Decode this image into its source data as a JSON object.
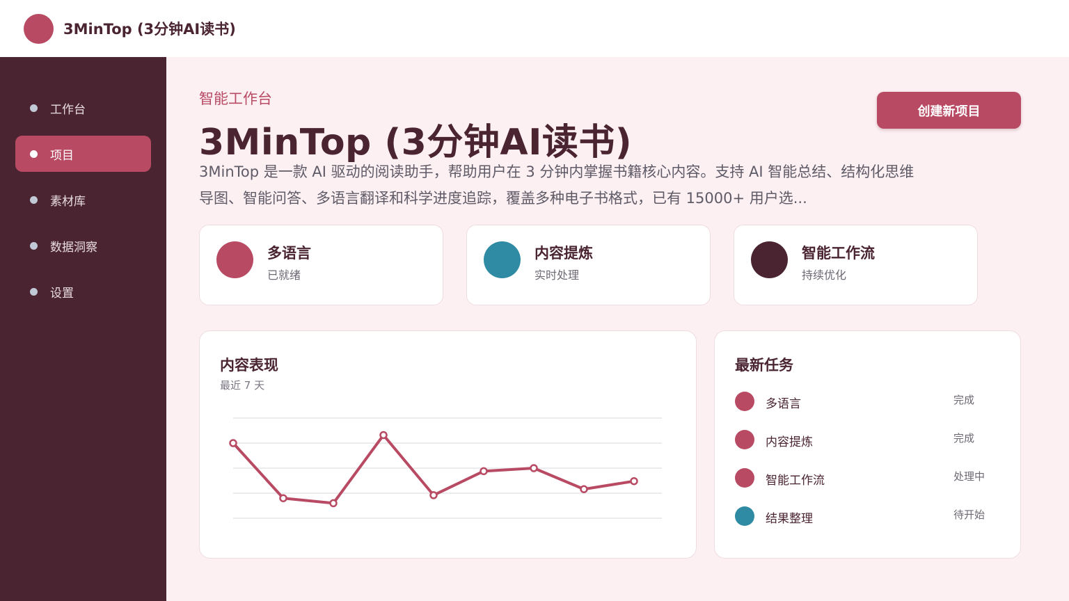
{
  "app": {
    "name": "3MinTop (3分钟AI读书)"
  },
  "sidebar": {
    "items": [
      {
        "label": "工作台",
        "active": false
      },
      {
        "label": "项目",
        "active": true
      },
      {
        "label": "素材库",
        "active": false
      },
      {
        "label": "数据洞察",
        "active": false
      },
      {
        "label": "设置",
        "active": false
      }
    ]
  },
  "header": {
    "eyebrow": "智能工作台",
    "title": "3MinTop (3分钟AI读书)",
    "description": "3MinTop 是一款 AI 驱动的阅读助手，帮助用户在 3 分钟内掌握书籍核心内容。支持 AI 智能总结、结构化思维导图、智能问答、多语言翻译和科学进度追踪，覆盖多种电子书格式，已有 15000+ 用户选...",
    "create_button": "创建新项目"
  },
  "features": [
    {
      "title": "多语言",
      "status": "已就绪",
      "color": "#b84a63"
    },
    {
      "title": "内容提炼",
      "status": "实时处理",
      "color": "#2e8ba3"
    },
    {
      "title": "智能工作流",
      "status": "持续优化",
      "color": "#4a2430"
    }
  ],
  "chart_panel": {
    "title": "内容表现",
    "subtitle": "最近 7 天"
  },
  "chart_data": {
    "type": "line",
    "title": "",
    "xlabel": "",
    "ylabel": "",
    "grid": true,
    "ylim": [
      0,
      100
    ],
    "x": [
      1,
      2,
      3,
      4,
      5,
      6,
      7,
      8,
      9
    ],
    "series": [
      {
        "values": [
          75,
          20,
          15,
          83,
          23,
          47,
          50,
          29,
          37
        ],
        "color": "#b84a63"
      }
    ]
  },
  "tasks_panel": {
    "title": "最新任务",
    "items": [
      {
        "name": "多语言",
        "status": "完成",
        "color": "#b84a63"
      },
      {
        "name": "内容提炼",
        "status": "完成",
        "color": "#b84a63"
      },
      {
        "name": "智能工作流",
        "status": "处理中",
        "color": "#b84a63"
      },
      {
        "name": "结果整理",
        "status": "待开始",
        "color": "#2e8ba3"
      }
    ]
  }
}
